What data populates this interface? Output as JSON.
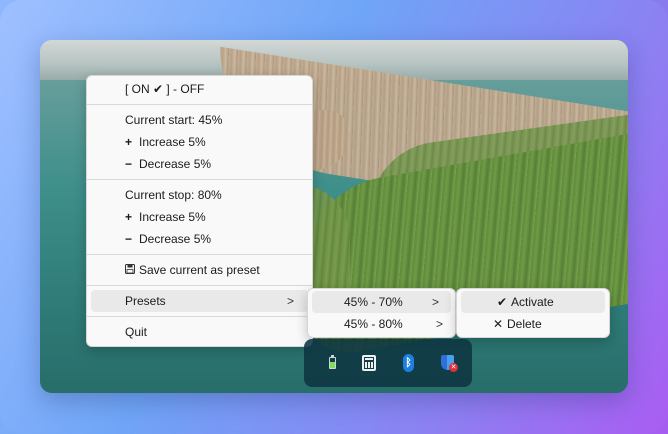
{
  "menu": {
    "toggle_label": "[ ON ✔ ] - OFF",
    "start_label": "Current start: 45%",
    "increase_start": "Increase 5%",
    "decrease_start": "Decrease 5%",
    "stop_label": "Current stop: 80%",
    "increase_stop": "Increase 5%",
    "decrease_stop": "Decrease 5%",
    "save_preset": "Save current as preset",
    "presets": "Presets",
    "quit": "Quit"
  },
  "presets_submenu": {
    "items": [
      "45% - 70%",
      "45% - 80%"
    ]
  },
  "preset_actions": {
    "activate": "Activate",
    "delete": "Delete"
  },
  "glyphs": {
    "plus": "+",
    "minus": "−",
    "arrow": ">",
    "check": "✔",
    "cross": "✕",
    "bluetooth": "ᛒ",
    "x_small": "✕"
  },
  "tray": {
    "icons": [
      "battery-icon",
      "calculator-icon",
      "bluetooth-icon",
      "security-shield-icon"
    ]
  }
}
